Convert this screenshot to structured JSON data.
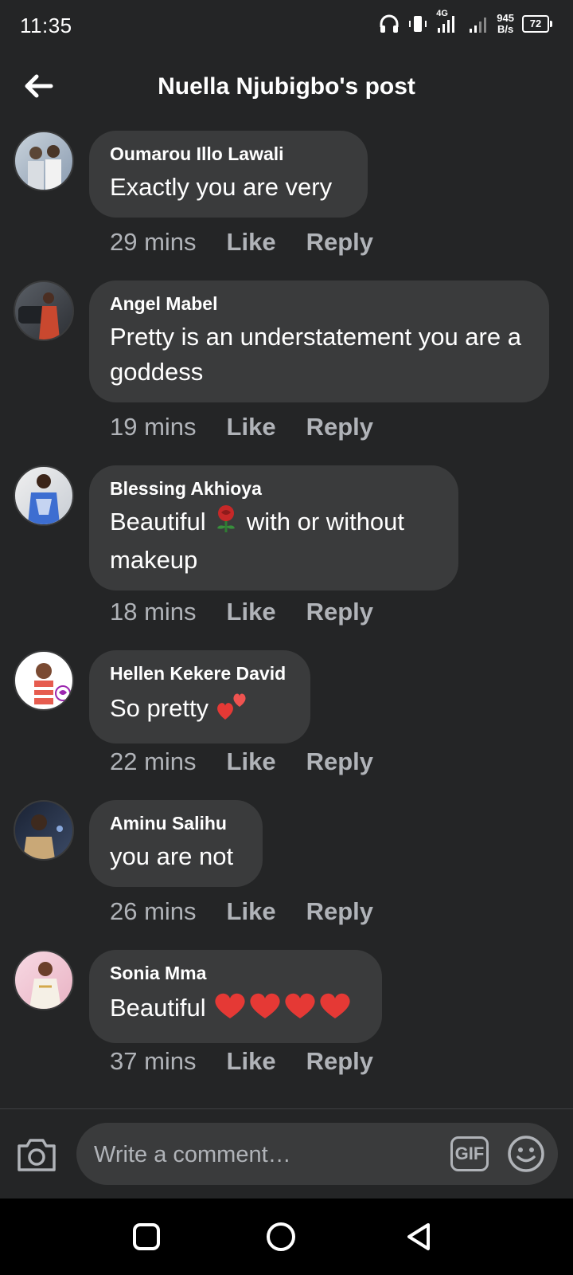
{
  "status_bar": {
    "time": "11:35",
    "network": "4G",
    "speed_value": "945",
    "speed_unit": "B/s",
    "battery": "72"
  },
  "header": {
    "title": "Nuella Njubigbo's post",
    "back_icon": "arrow-left-icon"
  },
  "comments": [
    {
      "author": "Oumarou Illo Lawali",
      "text": "Exactly you are very",
      "time": "29 mins",
      "like": "Like",
      "reply": "Reply",
      "avatar_color": "#8a9bb0"
    },
    {
      "author": "Angel Mabel",
      "text": "Pretty is an understatement you are a goddess",
      "time": "19 mins",
      "like": "Like",
      "reply": "Reply",
      "avatar_color": "#b5524a"
    },
    {
      "author": "Blessing Akhioya",
      "text_before": "Beautiful",
      "text_after": "with or without makeup",
      "emoji": "rose",
      "time": "18 mins",
      "like": "Like",
      "reply": "Reply",
      "avatar_color": "#4a78c9"
    },
    {
      "author": "Hellen Kekere David",
      "text": "So pretty",
      "emoji": "two-hearts",
      "time": "22 mins",
      "like": "Like",
      "reply": "Reply",
      "avatar_color": "#d8c7b0"
    },
    {
      "author": "Aminu Salihu",
      "text": "you are not",
      "time": "26 mins",
      "like": "Like",
      "reply": "Reply",
      "avatar_color": "#2b3a55"
    },
    {
      "author": "Sonia Mma",
      "text": "Beautiful",
      "emoji": "red-heart x4",
      "time": "37 mins",
      "like": "Like",
      "reply": "Reply",
      "avatar_color": "#e9b3c4"
    }
  ],
  "composer": {
    "placeholder": "Write a comment…",
    "gif_label": "GIF"
  },
  "colors": {
    "background": "#242526",
    "bubble": "#3a3b3c",
    "secondary_text": "#b0b3b8"
  }
}
